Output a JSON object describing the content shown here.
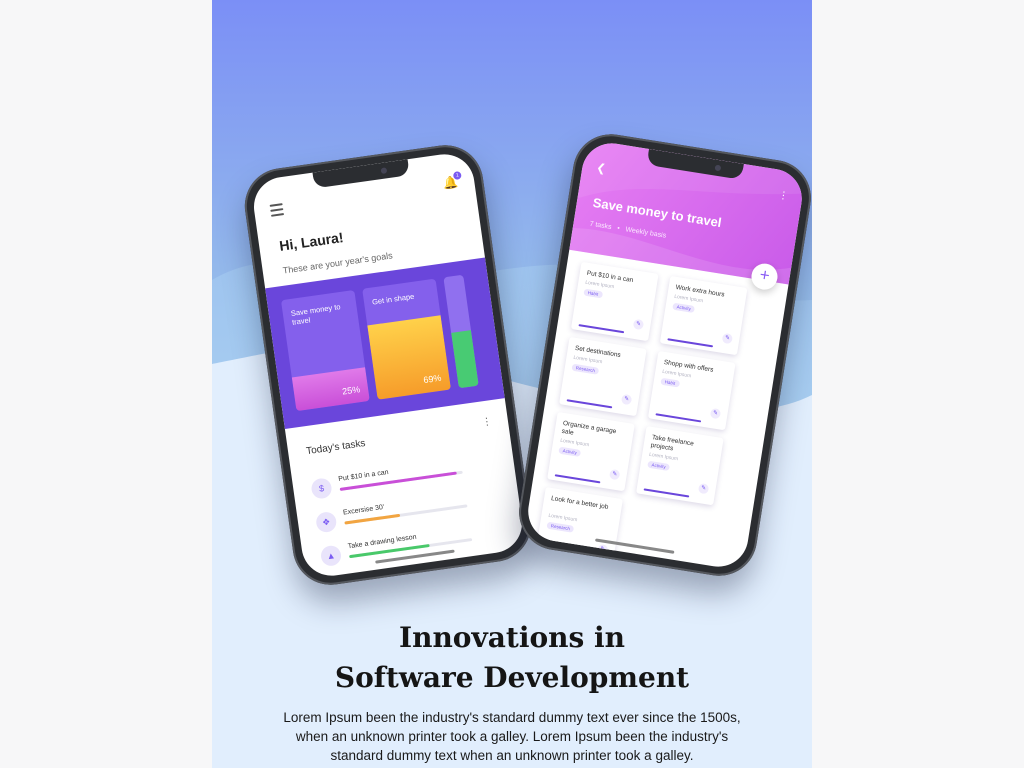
{
  "colors": {
    "gradient_top": "#7b8ff6",
    "gradient_bottom": "#8fb3ee",
    "wave_light": "#e1eefd",
    "accent": "#7b5cf2",
    "pink": "#d05fe0"
  },
  "phone_left": {
    "menu_icon": "hamburger-menu-icon",
    "bell_icon": "bell-icon",
    "bell_badge": "1",
    "greeting": "Hi, Laura!",
    "subtitle": "These are your year's goals",
    "goal_cards": [
      {
        "label": "Save money to travel",
        "percent_label": "25%",
        "fill_level": 0.3
      },
      {
        "label": "Get in shape",
        "percent_label": "69%",
        "fill_level": 0.67
      },
      {
        "label": "",
        "percent_label": "",
        "fill_level": 0.5
      }
    ],
    "tasks_title": "Today's tasks",
    "tasks_menu_icon": "more-vertical-icon",
    "tasks": [
      {
        "label": "Put $10 in a can",
        "icon": "dollar-icon",
        "progress": 0.95,
        "color": "#c94fd8"
      },
      {
        "label": "Excersise 30'",
        "icon": "dumbbell-icon",
        "progress": 0.45,
        "color": "#f2a541"
      },
      {
        "label": "Take a drawing lesson",
        "icon": "graduation-cap-icon",
        "progress": 0.65,
        "color": "#49c96a"
      }
    ]
  },
  "phone_right": {
    "back_icon": "chevron-left-icon",
    "menu_icon": "more-vertical-icon",
    "title": "Save money to travel",
    "task_count": "7 tasks",
    "frequency": "Weekly basis",
    "add_icon": "plus-icon",
    "task_cards": [
      {
        "title": "Put $10 in a can",
        "subtitle": "Lorem Ipsum",
        "tag": "Habit"
      },
      {
        "title": "Work extra hours",
        "subtitle": "Lorem Ipsum",
        "tag": "Activity"
      },
      {
        "title": "Set destinations",
        "subtitle": "Lorem Ipsum",
        "tag": "Research"
      },
      {
        "title": "Shopp with offers",
        "subtitle": "Lorem Ipsum",
        "tag": "Habit"
      },
      {
        "title": "Organize a garage sale",
        "subtitle": "Lorem Ipsum",
        "tag": "Activity"
      },
      {
        "title": "Take freelance projects",
        "subtitle": "Lorem Ipsum",
        "tag": "Activity"
      },
      {
        "title": "Look for a better job",
        "subtitle": "Lorem Ipsum",
        "tag": "Research"
      }
    ]
  },
  "headline": {
    "line1": "Innovations in",
    "line2": "Software Development"
  },
  "body_text": "Lorem Ipsum been the industry's standard dummy text ever since the 1500s, when an unknown printer took a galley. Lorem Ipsum been the industry's standard dummy text when an unknown printer took a galley."
}
